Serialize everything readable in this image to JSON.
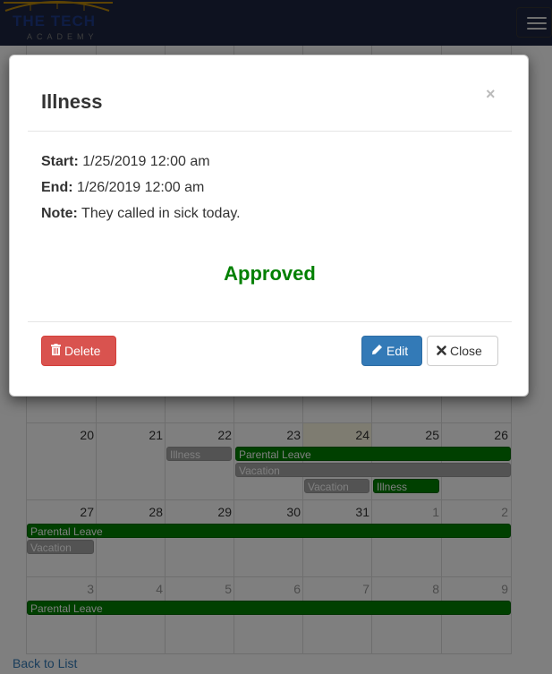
{
  "navbar": {
    "logo_line1": "THE TECH",
    "logo_line2": "ACADEMY"
  },
  "calendar": {
    "weeks": [
      {
        "days": [
          "20",
          "21",
          "22",
          "23",
          "24",
          "25",
          "26"
        ]
      },
      {
        "days": [
          "27",
          "28",
          "29",
          "30",
          "31",
          "1",
          "2"
        ]
      },
      {
        "days": [
          "3",
          "4",
          "5",
          "6",
          "7",
          "8",
          "9"
        ]
      }
    ],
    "today": "24",
    "events": {
      "w1_illness_a": "Illness",
      "w1_parental": "Parental Leave",
      "w1_vacation": "Vacation",
      "w1_vacation_b": "Vacation",
      "w1_illness_b": "Illness",
      "w2_parental": "Parental Leave",
      "w2_vacation": "Vacation",
      "w3_parental": "Parental Leave"
    }
  },
  "back_link": "Back to List",
  "modal": {
    "title": "Illness",
    "close_x": "×",
    "start_label": "Start:",
    "start_value": "1/25/2019 12:00 am",
    "end_label": "End:",
    "end_value": "1/26/2019 12:00 am",
    "note_label": "Note:",
    "note_value": "They called in sick today.",
    "status": "Approved",
    "delete_label": "Delete",
    "edit_label": "Edit",
    "close_label": "Close"
  },
  "colors": {
    "navbar": "#1c2541",
    "approved": "#008000",
    "delete": "#d9534f",
    "edit": "#337ab7",
    "event_green": "#008000",
    "event_gray": "#a6a6a6"
  }
}
